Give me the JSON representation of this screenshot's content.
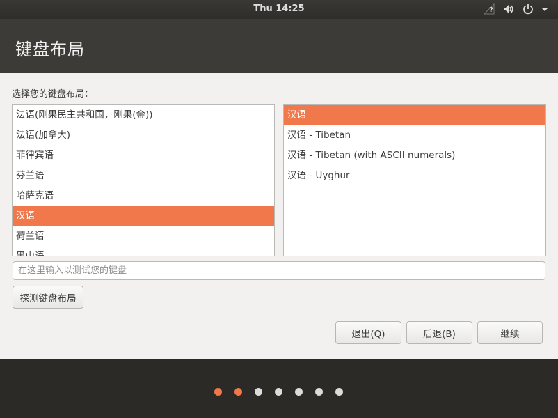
{
  "top_panel": {
    "clock": "Thu 14:25",
    "icons": [
      "network-question-icon",
      "volume-icon",
      "power-icon"
    ]
  },
  "header": {
    "title": "键盘布局"
  },
  "main": {
    "prompt": "选择您的键盘布局：",
    "layouts": [
      {
        "label": "法语(刚果民主共和国，刚果(金))",
        "selected": false
      },
      {
        "label": "法语(加拿大)",
        "selected": false
      },
      {
        "label": "菲律宾语",
        "selected": false
      },
      {
        "label": "芬兰语",
        "selected": false
      },
      {
        "label": "哈萨克语",
        "selected": false
      },
      {
        "label": "汉语",
        "selected": true
      },
      {
        "label": "荷兰语",
        "selected": false
      },
      {
        "label": "黑山语",
        "selected": false
      }
    ],
    "variants": [
      {
        "label": "汉语",
        "selected": true
      },
      {
        "label": "汉语 - Tibetan",
        "selected": false
      },
      {
        "label": "汉语 - Tibetan (with ASCII numerals)",
        "selected": false
      },
      {
        "label": "汉语 - Uyghur",
        "selected": false
      }
    ],
    "test_input": {
      "placeholder": "在这里输入以测试您的键盘",
      "value": ""
    },
    "detect_button": "探测键盘布局",
    "quit_button": "退出(Q)",
    "back_button": "后退(B)",
    "continue_button": "继续"
  },
  "progress": {
    "total_steps": 7,
    "completed_steps": 2
  },
  "colors": {
    "accent": "#f0784a",
    "header_bg": "#3c3b37",
    "content_bg": "#f2f1f0",
    "dot_inactive": "#dcdcdc"
  }
}
